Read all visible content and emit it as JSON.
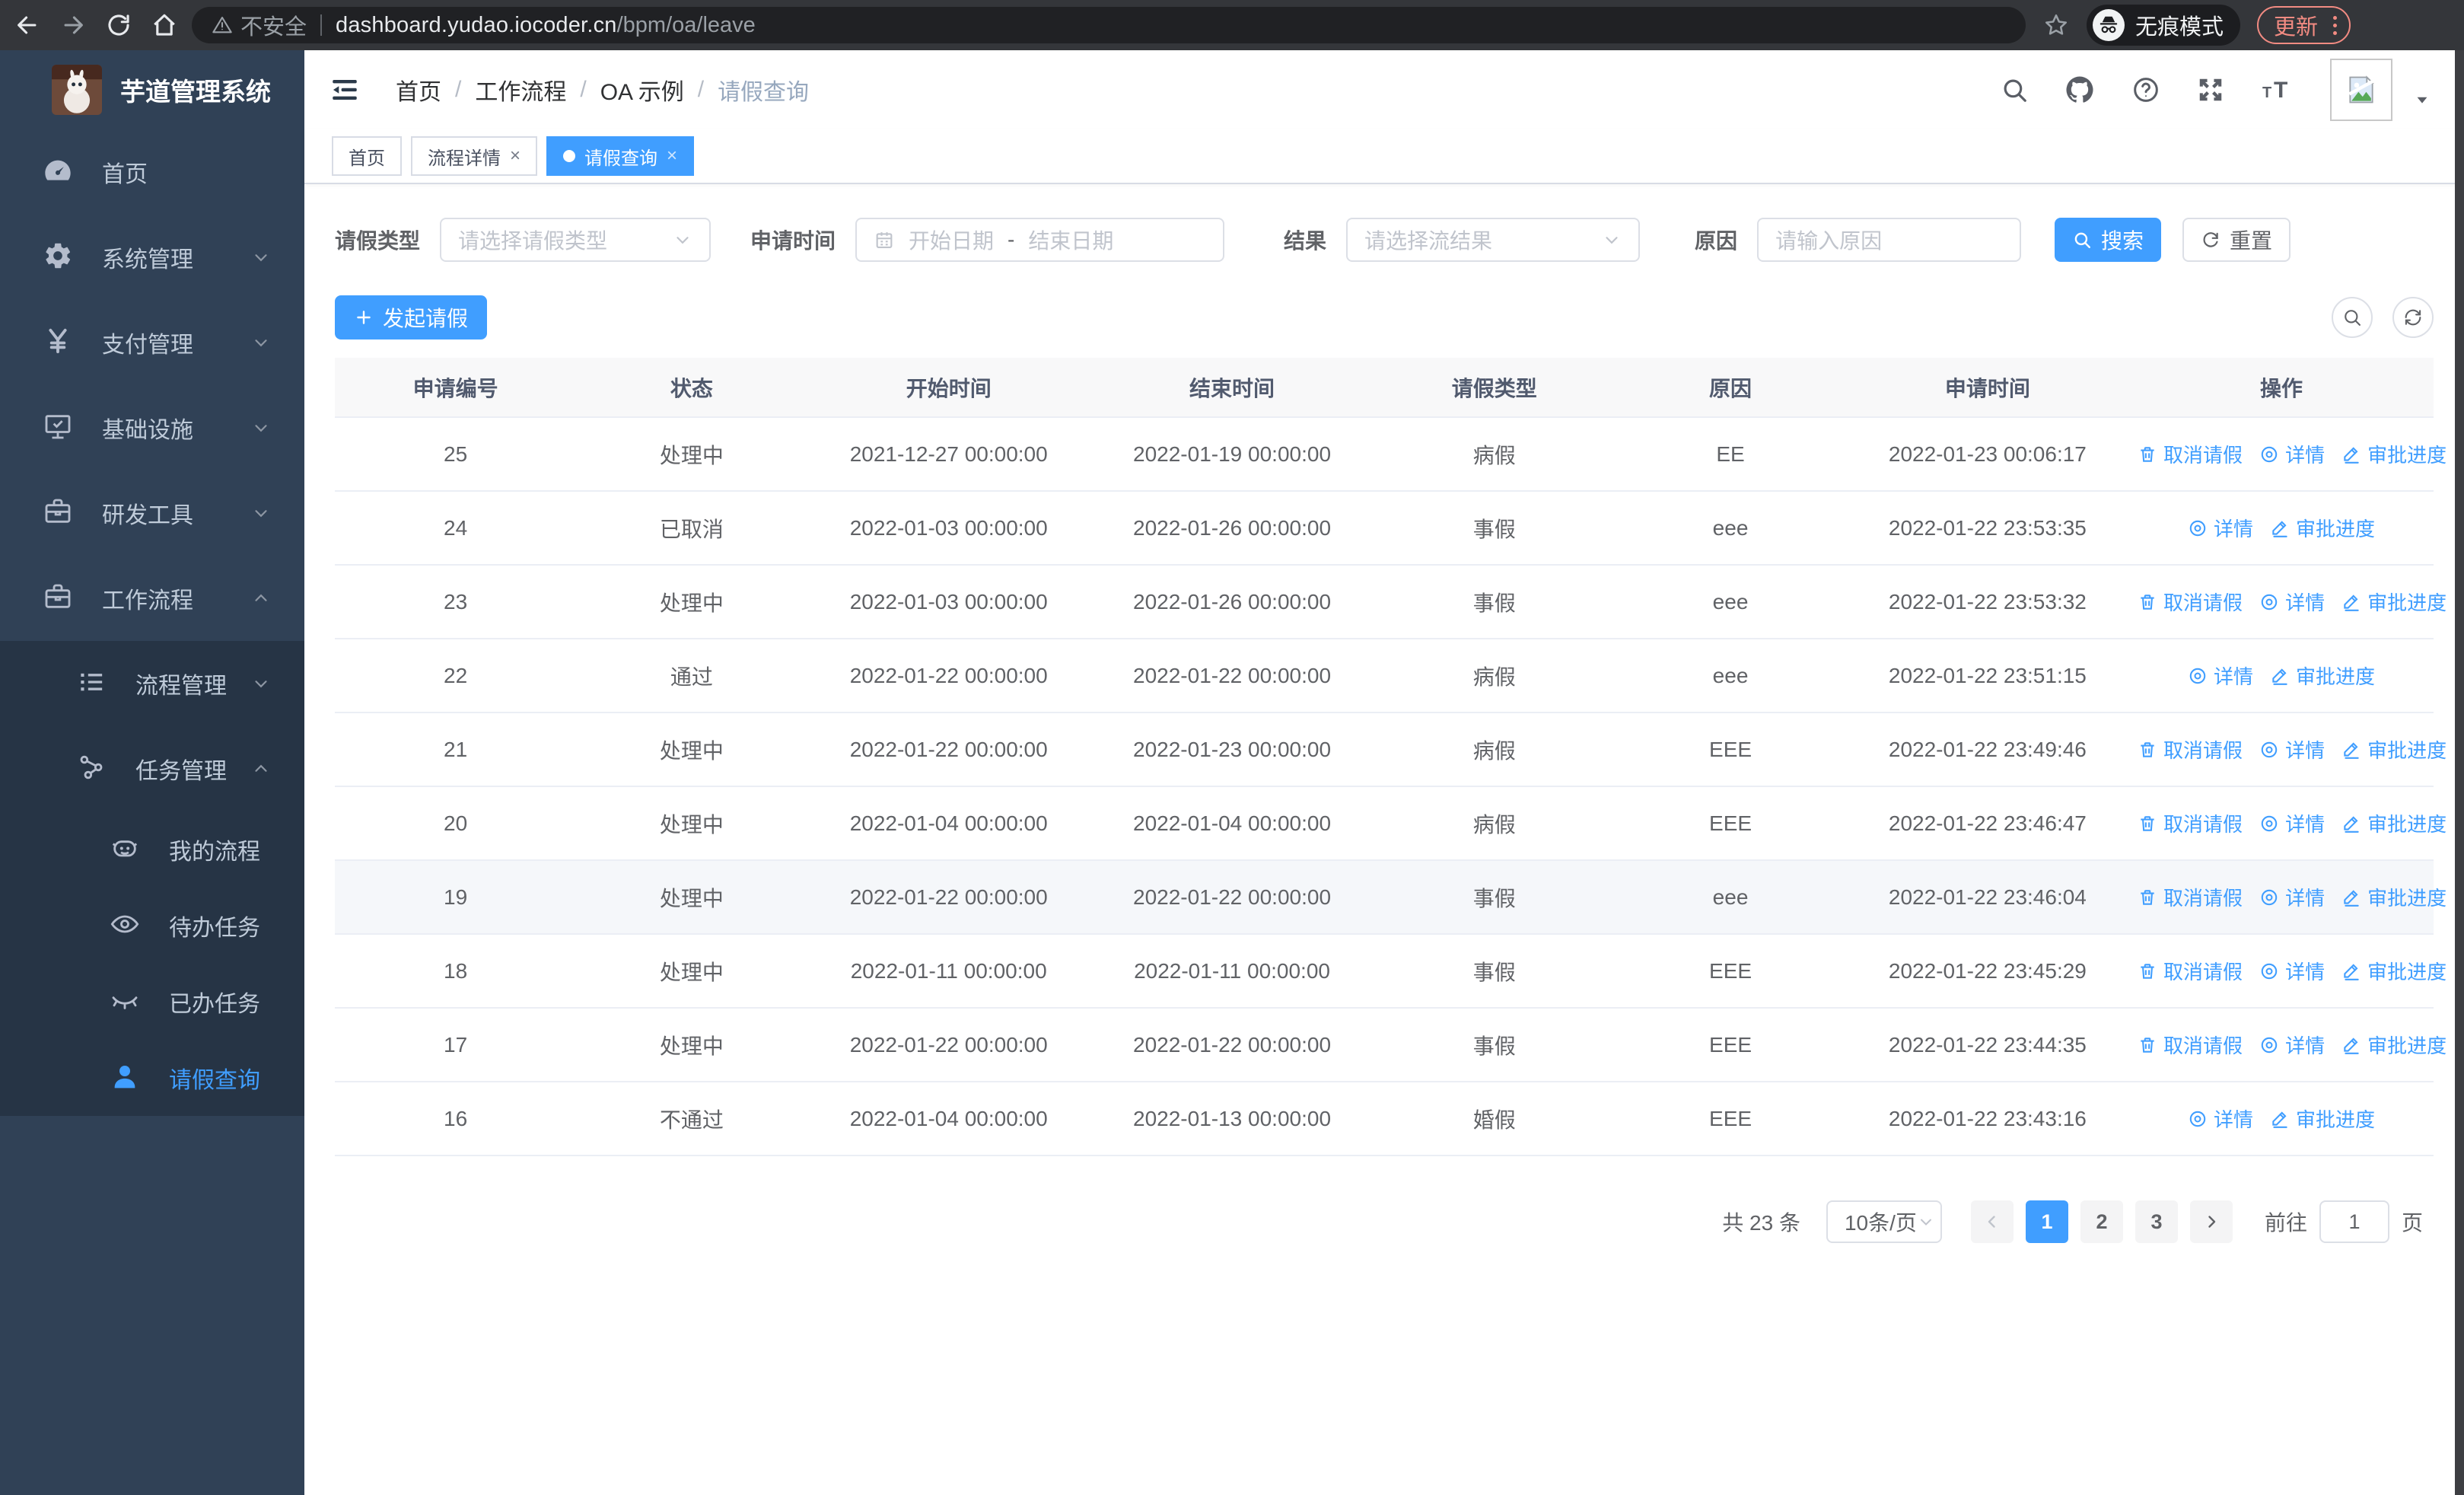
{
  "browser": {
    "security_label": "不安全",
    "url_host": "dashboard.yudao.iocoder.cn",
    "url_path": "/bpm/oa/leave",
    "incognito_label": "无痕模式",
    "update_label": "更新"
  },
  "sidebar": {
    "title": "芋道管理系统",
    "items": [
      {
        "label": "首页",
        "icon": "dashboard-icon",
        "level": 1,
        "chevron": "",
        "sub": false,
        "active": false
      },
      {
        "label": "系统管理",
        "icon": "gear-icon",
        "level": 1,
        "chevron": "down",
        "sub": false,
        "active": false
      },
      {
        "label": "支付管理",
        "icon": "yen-icon",
        "level": 1,
        "chevron": "down",
        "sub": false,
        "active": false
      },
      {
        "label": "基础设施",
        "icon": "infra-icon",
        "level": 1,
        "chevron": "down",
        "sub": false,
        "active": false
      },
      {
        "label": "研发工具",
        "icon": "toolbox-icon",
        "level": 1,
        "chevron": "down",
        "sub": false,
        "active": false
      },
      {
        "label": "工作流程",
        "icon": "workflow-icon",
        "level": 1,
        "chevron": "up",
        "sub": false,
        "active": false
      },
      {
        "label": "流程管理",
        "icon": "process-icon",
        "level": 2,
        "chevron": "down",
        "sub": true,
        "active": false
      },
      {
        "label": "任务管理",
        "icon": "task-icon",
        "level": 2,
        "chevron": "up",
        "sub": true,
        "active": false
      },
      {
        "label": "我的流程",
        "icon": "robot-icon",
        "level": 3,
        "chevron": "",
        "sub": true,
        "active": false
      },
      {
        "label": "待办任务",
        "icon": "eye-icon",
        "level": 3,
        "chevron": "",
        "sub": true,
        "active": false
      },
      {
        "label": "已办任务",
        "icon": "eye-closed-icon",
        "level": 3,
        "chevron": "",
        "sub": true,
        "active": false
      },
      {
        "label": "请假查询",
        "icon": "user-icon",
        "level": 3,
        "chevron": "",
        "sub": true,
        "active": true
      }
    ]
  },
  "header": {
    "breadcrumb": [
      {
        "label": "首页",
        "current": false
      },
      {
        "label": "工作流程",
        "current": false
      },
      {
        "label": "OA 示例",
        "current": false
      },
      {
        "label": "请假查询",
        "current": true
      }
    ]
  },
  "tabs": [
    {
      "label": "首页",
      "closable": false,
      "active": false
    },
    {
      "label": "流程详情",
      "closable": true,
      "active": false
    },
    {
      "label": "请假查询",
      "closable": true,
      "active": true
    }
  ],
  "filters": {
    "leave_type_label": "请假类型",
    "leave_type_placeholder": "请选择请假类型",
    "apply_time_label": "申请时间",
    "start_date_placeholder": "开始日期",
    "range_separator": "-",
    "end_date_placeholder": "结束日期",
    "result_label": "结果",
    "result_placeholder": "请选择流结果",
    "reason_label": "原因",
    "reason_placeholder": "请输入原因",
    "search_label": "搜索",
    "reset_label": "重置"
  },
  "toolbar": {
    "create_label": "发起请假"
  },
  "table": {
    "columns": [
      "申请编号",
      "状态",
      "开始时间",
      "结束时间",
      "请假类型",
      "原因",
      "申请时间",
      "操作"
    ],
    "action_defs": {
      "cancel": {
        "label": "取消请假",
        "icon": "trash-icon"
      },
      "detail": {
        "label": "详情",
        "icon": "view-icon"
      },
      "progress": {
        "label": "审批进度",
        "icon": "edit-icon"
      }
    },
    "rows": [
      {
        "id": "25",
        "status": "处理中",
        "start": "2021-12-27 00:00:00",
        "end": "2022-01-19 00:00:00",
        "type": "病假",
        "reason": "EE",
        "apply_time": "2022-01-23 00:06:17",
        "actions": [
          "cancel",
          "detail",
          "progress"
        ],
        "highlight": false
      },
      {
        "id": "24",
        "status": "已取消",
        "start": "2022-01-03 00:00:00",
        "end": "2022-01-26 00:00:00",
        "type": "事假",
        "reason": "eee",
        "apply_time": "2022-01-22 23:53:35",
        "actions": [
          "detail",
          "progress"
        ],
        "highlight": false
      },
      {
        "id": "23",
        "status": "处理中",
        "start": "2022-01-03 00:00:00",
        "end": "2022-01-26 00:00:00",
        "type": "事假",
        "reason": "eee",
        "apply_time": "2022-01-22 23:53:32",
        "actions": [
          "cancel",
          "detail",
          "progress"
        ],
        "highlight": false
      },
      {
        "id": "22",
        "status": "通过",
        "start": "2022-01-22 00:00:00",
        "end": "2022-01-22 00:00:00",
        "type": "病假",
        "reason": "eee",
        "apply_time": "2022-01-22 23:51:15",
        "actions": [
          "detail",
          "progress"
        ],
        "highlight": false
      },
      {
        "id": "21",
        "status": "处理中",
        "start": "2022-01-22 00:00:00",
        "end": "2022-01-23 00:00:00",
        "type": "病假",
        "reason": "EEE",
        "apply_time": "2022-01-22 23:49:46",
        "actions": [
          "cancel",
          "detail",
          "progress"
        ],
        "highlight": false
      },
      {
        "id": "20",
        "status": "处理中",
        "start": "2022-01-04 00:00:00",
        "end": "2022-01-04 00:00:00",
        "type": "病假",
        "reason": "EEE",
        "apply_time": "2022-01-22 23:46:47",
        "actions": [
          "cancel",
          "detail",
          "progress"
        ],
        "highlight": false
      },
      {
        "id": "19",
        "status": "处理中",
        "start": "2022-01-22 00:00:00",
        "end": "2022-01-22 00:00:00",
        "type": "事假",
        "reason": "eee",
        "apply_time": "2022-01-22 23:46:04",
        "actions": [
          "cancel",
          "detail",
          "progress"
        ],
        "highlight": true
      },
      {
        "id": "18",
        "status": "处理中",
        "start": "2022-01-11 00:00:00",
        "end": "2022-01-11 00:00:00",
        "type": "事假",
        "reason": "EEE",
        "apply_time": "2022-01-22 23:45:29",
        "actions": [
          "cancel",
          "detail",
          "progress"
        ],
        "highlight": false
      },
      {
        "id": "17",
        "status": "处理中",
        "start": "2022-01-22 00:00:00",
        "end": "2022-01-22 00:00:00",
        "type": "事假",
        "reason": "EEE",
        "apply_time": "2022-01-22 23:44:35",
        "actions": [
          "cancel",
          "detail",
          "progress"
        ],
        "highlight": false
      },
      {
        "id": "16",
        "status": "不通过",
        "start": "2022-01-04 00:00:00",
        "end": "2022-01-13 00:00:00",
        "type": "婚假",
        "reason": "EEE",
        "apply_time": "2022-01-22 23:43:16",
        "actions": [
          "detail",
          "progress"
        ],
        "highlight": false
      }
    ]
  },
  "pagination": {
    "total_label": "共 23 条",
    "page_size": "10条/页",
    "pages": [
      {
        "label": "1",
        "active": true
      },
      {
        "label": "2",
        "active": false
      },
      {
        "label": "3",
        "active": false
      }
    ],
    "goto_label": "前往",
    "goto_value": "1",
    "page_unit": "页"
  },
  "colors": {
    "accent_blue": "#409eff",
    "sidebar_bg": "#304156",
    "submenu_bg": "#263445",
    "sidebar_text": "#bfcbd9",
    "table_header_bg": "#f8f8f9",
    "row_highlight_bg": "#f5f7fa",
    "update_coral": "#f28b82"
  },
  "icons": {
    "browser": [
      "back-icon",
      "forward-icon",
      "reload-icon",
      "home-icon",
      "warning-icon",
      "star-icon",
      "incognito-icon",
      "more-vert-icon"
    ],
    "header": [
      "hamburger-icon",
      "search-icon",
      "github-icon",
      "question-icon",
      "fullscreen-icon",
      "fontsize-icon",
      "broken-image-icon",
      "caret-down-icon"
    ],
    "filters": [
      "chevron-down-icon",
      "calendar-icon",
      "search-icon",
      "refresh-icon"
    ],
    "toolbar": [
      "plus-icon",
      "zoom-icon",
      "refresh-icon"
    ],
    "table_actions": [
      "trash-icon",
      "view-icon",
      "edit-icon"
    ],
    "pagination": [
      "chevron-left-icon",
      "chevron-right-icon"
    ]
  }
}
